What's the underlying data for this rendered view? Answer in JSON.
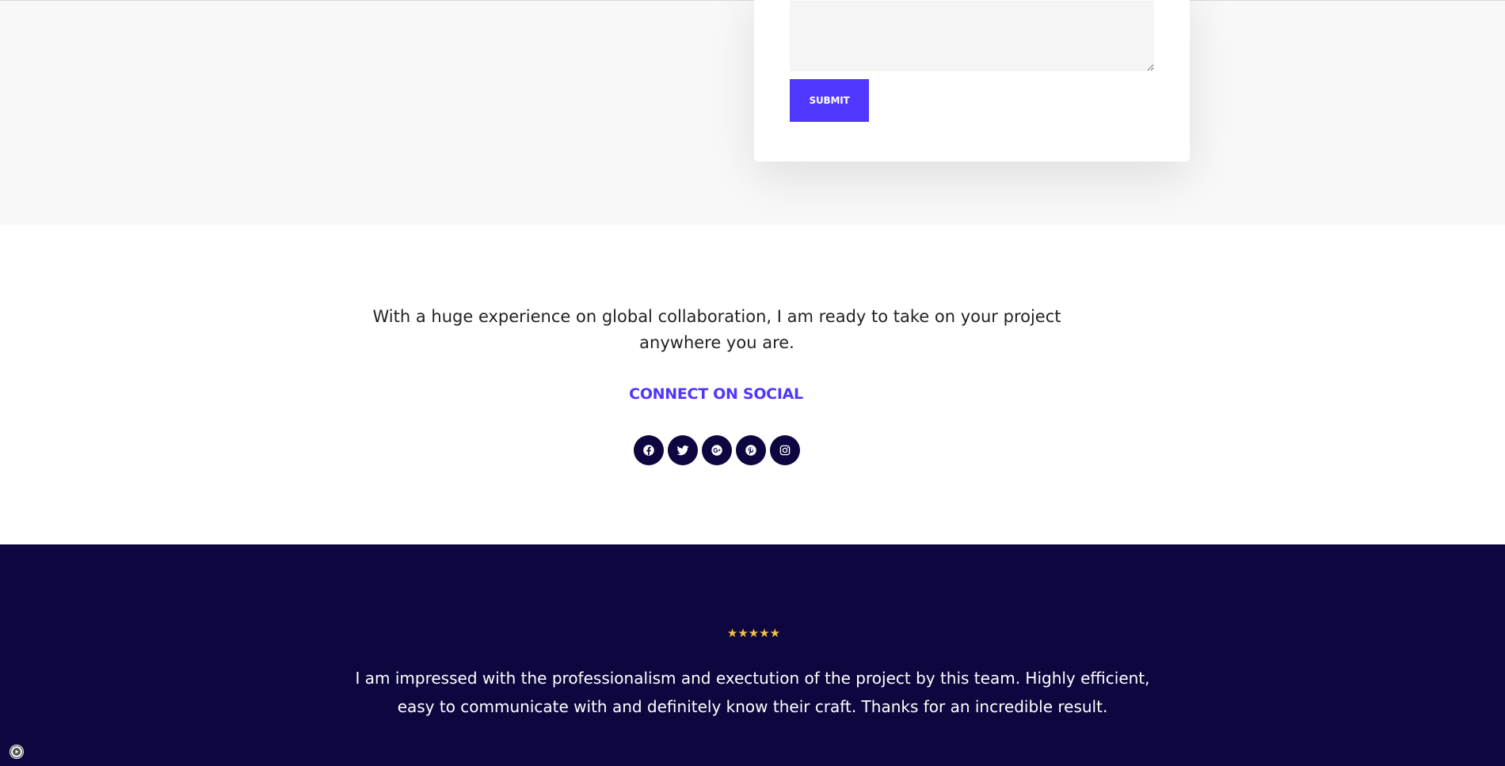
{
  "form": {
    "message_value": "",
    "submit_label": "SUBMIT"
  },
  "social": {
    "intro_text": "With a huge experience on global collaboration, I am ready to take on your project anywhere you are.",
    "heading": "CONNECT ON SOCIAL",
    "icons": [
      "facebook-icon",
      "twitter-icon",
      "google-plus-icon",
      "pinterest-icon",
      "instagram-icon"
    ]
  },
  "testimonial": {
    "stars": "★★★★★",
    "rating": 5,
    "text": "I am impressed with the professionalism and exectution of the project by this team. Highly efficient, easy to communicate with and definitely know their craft. Thanks for an incredible result."
  },
  "colors": {
    "accent": "#4f37fd",
    "dark_navy": "#0e073f",
    "star_gold": "#f5c242",
    "light_bg": "#f8f8f8"
  }
}
